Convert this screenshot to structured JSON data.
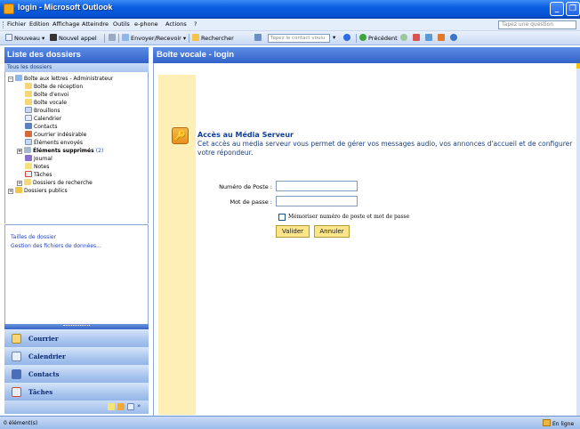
{
  "window": {
    "title": "login - Microsoft Outlook",
    "min_glyph": "_",
    "max_glyph": "❐"
  },
  "menu": {
    "items": [
      "Fichier",
      "Edition",
      "Affichage",
      "Atteindre",
      "Outils",
      "e-phone",
      "Actions",
      "?"
    ],
    "help_placeholder": "Tapez une question"
  },
  "toolbar": {
    "new": "Nouveau",
    "new_call": "Nouvel appel",
    "send_receive": "Envoyer/Recevoir",
    "search": "Rechercher",
    "contact_placeholder": "Tapez le contact voulu",
    "previous": "Précédent"
  },
  "left_pane": {
    "title": "Liste des dossiers",
    "subtitle": "Tous les dossiers",
    "tree": [
      {
        "label": "Boîte aux lettres - Administrateur",
        "expander": "−"
      },
      {
        "label": "Boîte de réception"
      },
      {
        "label": "Boîte d'envoi"
      },
      {
        "label": "Boîte vocale"
      },
      {
        "label": "Brouillons"
      },
      {
        "label": "Calendrier"
      },
      {
        "label": "Contacts"
      },
      {
        "label": "Courrier indésirable"
      },
      {
        "label": "Éléments envoyés"
      },
      {
        "label": "Éléments supprimés",
        "count": "(2)",
        "expander": "+"
      },
      {
        "label": "Journal"
      },
      {
        "label": "Notes"
      },
      {
        "label": "Tâches"
      },
      {
        "label": "Dossiers de recherche",
        "expander": "+"
      },
      {
        "label": "Dossiers publics",
        "expander": "+"
      }
    ],
    "links": [
      "Tailles de dossier",
      "Gestion des fichiers de données..."
    ],
    "nav": [
      "Courrier",
      "Calendrier",
      "Contacts",
      "Tâches"
    ],
    "nav_more": "»"
  },
  "main": {
    "title": "Boîte vocale - login",
    "panel_title": "Accès au Média Serveur",
    "panel_desc": "Cet accès au media serveur vous permet de gérer vos messages audio, vos annonces d'accueil et de configurer votre répondeur.",
    "icon_glyph": "🔑",
    "form": {
      "poste_label": "Numéro de Poste :",
      "poste_value": "",
      "pass_label": "Mot de passe :",
      "pass_value": "",
      "remember_label": "Mémoriser numéro de poste et mot de passe",
      "remember_checked": false,
      "submit": "Valider",
      "cancel": "Annuler"
    }
  },
  "status": {
    "items": "0 élément(s)",
    "online": "En ligne"
  },
  "colors": {
    "header_blue": "#3362c8",
    "gutter_yellow": "#fdefb6",
    "button_yellow": "#fde58a",
    "link_blue": "#1f3fbf"
  }
}
